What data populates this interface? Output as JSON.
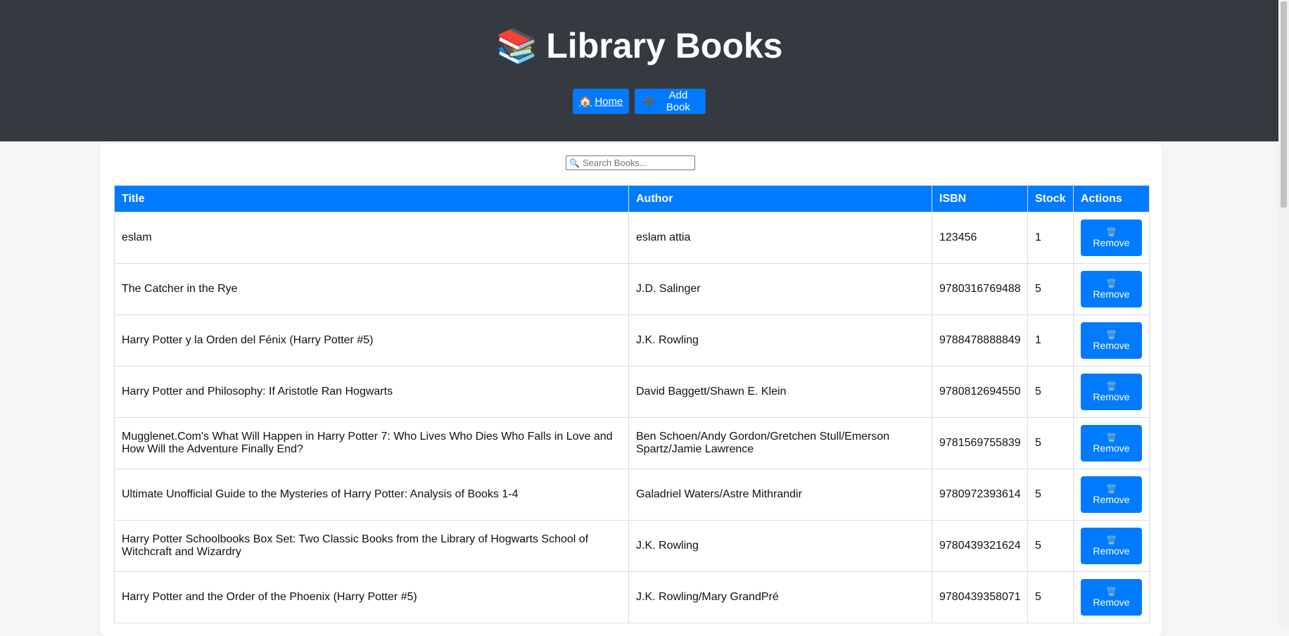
{
  "header": {
    "icon": "books-icon",
    "icon_glyph": "📚",
    "title": "Library Books",
    "nav": [
      {
        "label": "Home",
        "icon": "house-icon",
        "icon_glyph": "🏠"
      },
      {
        "label": "Add Book",
        "icon": "plus-icon",
        "icon_glyph": "➕"
      }
    ]
  },
  "search": {
    "icon_glyph": "🔍",
    "placeholder": "Search Books...",
    "value": ""
  },
  "table": {
    "columns": [
      "Title",
      "Author",
      "ISBN",
      "Stock",
      "Actions"
    ],
    "remove_label": "Remove",
    "remove_icon_glyph": "🗑️",
    "rows": [
      {
        "title": "eslam",
        "author": "eslam attia",
        "isbn": "123456",
        "stock": "1"
      },
      {
        "title": "The Catcher in the Rye",
        "author": "J.D. Salinger",
        "isbn": "9780316769488",
        "stock": "5"
      },
      {
        "title": "Harry Potter y la Orden del Fénix (Harry Potter #5)",
        "author": "J.K. Rowling",
        "isbn": "9788478888849",
        "stock": "1"
      },
      {
        "title": "Harry Potter and Philosophy: If Aristotle Ran Hogwarts",
        "author": "David Baggett/Shawn E. Klein",
        "isbn": "9780812694550",
        "stock": "5"
      },
      {
        "title": "Mugglenet.Com's What Will Happen in Harry Potter 7: Who Lives Who Dies Who Falls in Love and How Will the Adventure Finally End?",
        "author": "Ben Schoen/Andy Gordon/Gretchen Stull/Emerson Spartz/Jamie Lawrence",
        "isbn": "9781569755839",
        "stock": "5"
      },
      {
        "title": "Ultimate Unofficial Guide to the Mysteries of Harry Potter: Analysis of Books 1-4",
        "author": "Galadriel Waters/Astre Mithrandir",
        "isbn": "9780972393614",
        "stock": "5"
      },
      {
        "title": "Harry Potter Schoolbooks Box Set: Two Classic Books from the Library of Hogwarts School of Witchcraft and Wizardry",
        "author": "J.K. Rowling",
        "isbn": "9780439321624",
        "stock": "5"
      },
      {
        "title": "Harry Potter and the Order of the Phoenix (Harry Potter #5)",
        "author": "J.K. Rowling/Mary GrandPré",
        "isbn": "9780439358071",
        "stock": "5"
      }
    ]
  },
  "colors": {
    "header_bg": "#343a40",
    "accent": "#007bff",
    "page_bg": "#f4f6f8"
  }
}
